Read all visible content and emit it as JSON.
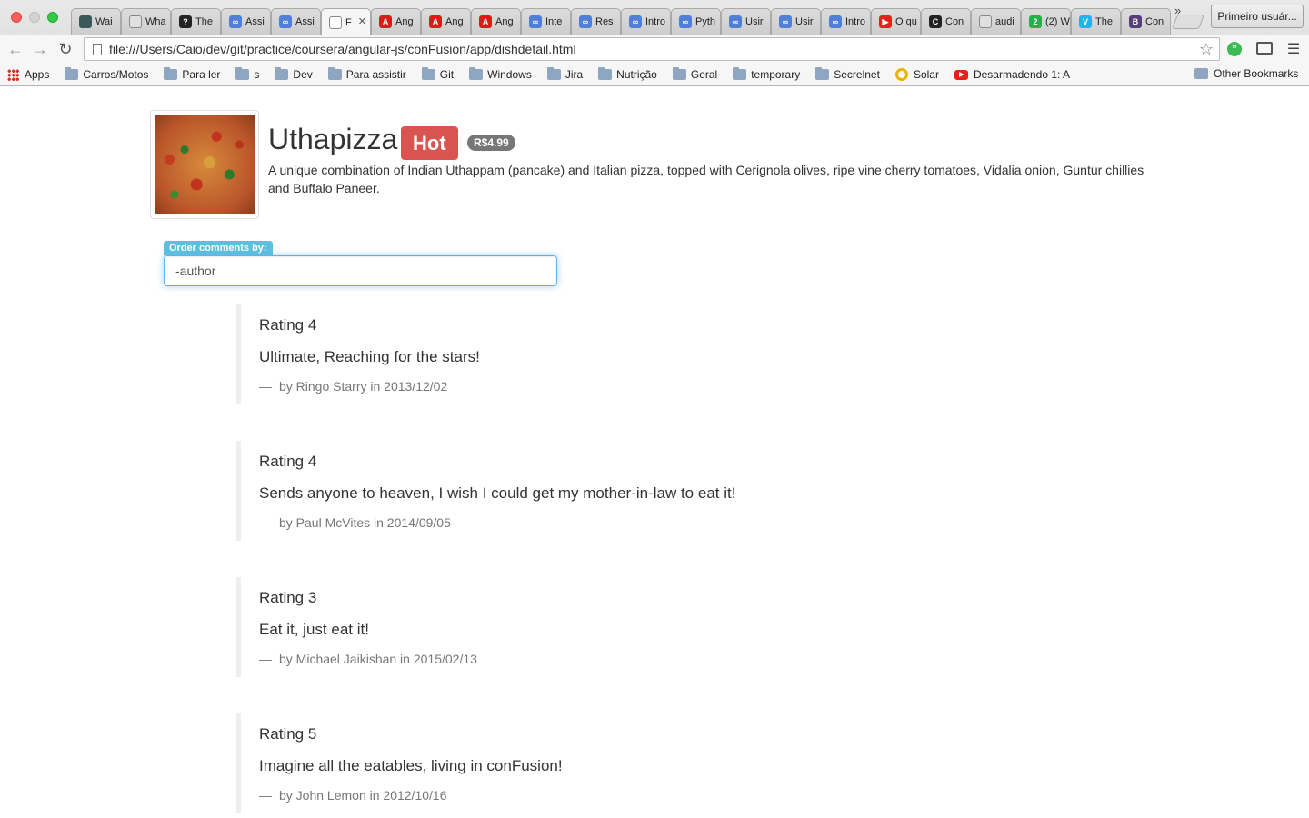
{
  "browser": {
    "tabs": [
      {
        "label": "Wai",
        "favicon_color": "#3a5a5a",
        "favicon_char": ""
      },
      {
        "label": "Wha",
        "favicon_color": "#e0e0e0",
        "favicon_char": ""
      },
      {
        "label": "The",
        "favicon_color": "#222222",
        "favicon_char": "?"
      },
      {
        "label": "Assi",
        "favicon_color": "#4f7fd6",
        "favicon_char": "∞"
      },
      {
        "label": "Assi",
        "favicon_color": "#4f7fd6",
        "favicon_char": "∞"
      },
      {
        "label": "F",
        "favicon_color": "#ffffff",
        "favicon_char": "",
        "active": true
      },
      {
        "label": "Ang",
        "favicon_color": "#dd1b16",
        "favicon_char": "A"
      },
      {
        "label": "Ang",
        "favicon_color": "#dd1b16",
        "favicon_char": "A"
      },
      {
        "label": "Ang",
        "favicon_color": "#dd1b16",
        "favicon_char": "A"
      },
      {
        "label": "Inte",
        "favicon_color": "#4f7fd6",
        "favicon_char": "∞"
      },
      {
        "label": "Res",
        "favicon_color": "#4f7fd6",
        "favicon_char": "∞"
      },
      {
        "label": "Intro",
        "favicon_color": "#4f7fd6",
        "favicon_char": "∞"
      },
      {
        "label": "Pyth",
        "favicon_color": "#4f7fd6",
        "favicon_char": "∞"
      },
      {
        "label": "Usir",
        "favicon_color": "#4f7fd6",
        "favicon_char": "∞"
      },
      {
        "label": "Usir",
        "favicon_color": "#4f7fd6",
        "favicon_char": "∞"
      },
      {
        "label": "Intro",
        "favicon_color": "#4f7fd6",
        "favicon_char": "∞"
      },
      {
        "label": "O qu",
        "favicon_color": "#e62117",
        "favicon_char": "▶"
      },
      {
        "label": "Con",
        "favicon_color": "#222222",
        "favicon_char": "C"
      },
      {
        "label": "audi",
        "favicon_color": "#e0e0e0",
        "favicon_char": ""
      },
      {
        "label": "(2) W",
        "favicon_color": "#25b14a",
        "favicon_char": "2"
      },
      {
        "label": "The",
        "favicon_color": "#1ab7ea",
        "favicon_char": "V"
      },
      {
        "label": "Con",
        "favicon_color": "#563d7c",
        "favicon_char": "B"
      }
    ],
    "user_button": "Primeiro usuár...",
    "url": "file:///Users/Caio/dev/git/practice/coursera/angular-js/conFusion/app/dishdetail.html",
    "bookmarks": [
      {
        "label": "Apps",
        "icon": "apps-icon"
      },
      {
        "label": "Carros/Motos",
        "icon": "folder-icon"
      },
      {
        "label": "Para ler",
        "icon": "folder-icon"
      },
      {
        "label": "s",
        "icon": "folder-icon"
      },
      {
        "label": "Dev",
        "icon": "folder-icon"
      },
      {
        "label": "Para assistir",
        "icon": "folder-icon"
      },
      {
        "label": "Git",
        "icon": "folder-icon"
      },
      {
        "label": "Windows",
        "icon": "folder-icon"
      },
      {
        "label": "Jira",
        "icon": "folder-icon"
      },
      {
        "label": "Nutrição",
        "icon": "folder-icon"
      },
      {
        "label": "Geral",
        "icon": "folder-icon"
      },
      {
        "label": "temporary",
        "icon": "folder-icon"
      },
      {
        "label": "Secrelnet",
        "icon": "folder-icon"
      },
      {
        "label": "Solar",
        "icon": "solar-icon"
      },
      {
        "label": "Desarmadendo 1: A",
        "icon": "youtube-icon"
      }
    ],
    "more_bookmarks": "»",
    "other_bookmarks": "Other Bookmarks"
  },
  "dish": {
    "name": "Uthapizza",
    "label": "Hot",
    "price": "R$4.99",
    "description": "A unique combination of Indian Uthappam (pancake) and Italian pizza, topped with Cerignola olives, ripe vine cherry tomatoes, Vidalia onion, Guntur chillies and Buffalo Paneer."
  },
  "order": {
    "label": "Order comments by:",
    "value": "-author"
  },
  "comments": [
    {
      "rating": "Rating 4",
      "comment": "Ultimate, Reaching for the stars!",
      "dash": "—",
      "footer": "by Ringo Starry in 2013/12/02"
    },
    {
      "rating": "Rating 4",
      "comment": "Sends anyone to heaven, I wish I could get my mother-in-law to eat it!",
      "dash": "—",
      "footer": "by Paul McVites in 2014/09/05"
    },
    {
      "rating": "Rating 3",
      "comment": "Eat it, just eat it!",
      "dash": "—",
      "footer": "by Michael Jaikishan in 2015/02/13"
    },
    {
      "rating": "Rating 5",
      "comment": "Imagine all the eatables, living in conFusion!",
      "dash": "—",
      "footer": "by John Lemon in 2012/10/16"
    }
  ]
}
